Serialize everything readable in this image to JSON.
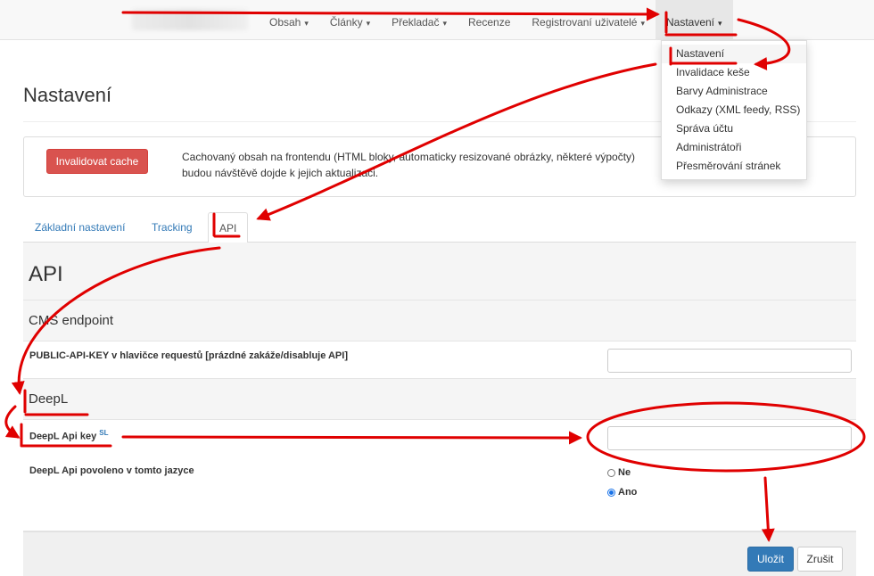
{
  "nav": {
    "items": [
      {
        "label": "Obsah",
        "caret": "▾"
      },
      {
        "label": "Články",
        "caret": "▾"
      },
      {
        "label": "Překladač",
        "caret": "▾"
      },
      {
        "label": "Recenze",
        "caret": ""
      },
      {
        "label": "Registrovaní uživatelé",
        "caret": "▾"
      },
      {
        "label": "Nastavení",
        "caret": "▾"
      }
    ]
  },
  "dropdown": {
    "items": [
      "Nastavení",
      "Invalidace keše",
      "Barvy Administrace",
      "Odkazy (XML feedy, RSS)",
      "Správa účtu",
      "Administrátoři",
      "Přesměrování stránek"
    ]
  },
  "page": {
    "title": "Nastavení"
  },
  "cache_panel": {
    "button_label": "Invalidovat cache",
    "description": "Cachovaný obsah na frontendu (HTML bloky, automaticky resizované obrázky, některé výpočty) budou návštěvě dojde k jejich aktualizaci."
  },
  "tabs": [
    "Základní nastavení",
    "Tracking",
    "API"
  ],
  "api": {
    "heading": "API",
    "cms_section": "CMS endpoint",
    "public_key_label": "PUBLIC-API-KEY v hlavičce requestů [prázdné zakáže/disabluje API]",
    "public_key_value": "",
    "deepl_section": "DeepL",
    "deepl_key_label": "DeepL Api key",
    "deepl_key_sup": "SL",
    "deepl_key_value": "",
    "deepl_enabled_label": "DeepL Api povoleno v tomto jazyce",
    "radio_no": "Ne",
    "radio_yes": "Ano",
    "selected": "Ano"
  },
  "footer": {
    "save_label": "Uložit",
    "cancel_label": "Zrušit"
  },
  "colors": {
    "annotation": "#e00000",
    "primary": "#337ab7",
    "danger": "#d9534f"
  }
}
